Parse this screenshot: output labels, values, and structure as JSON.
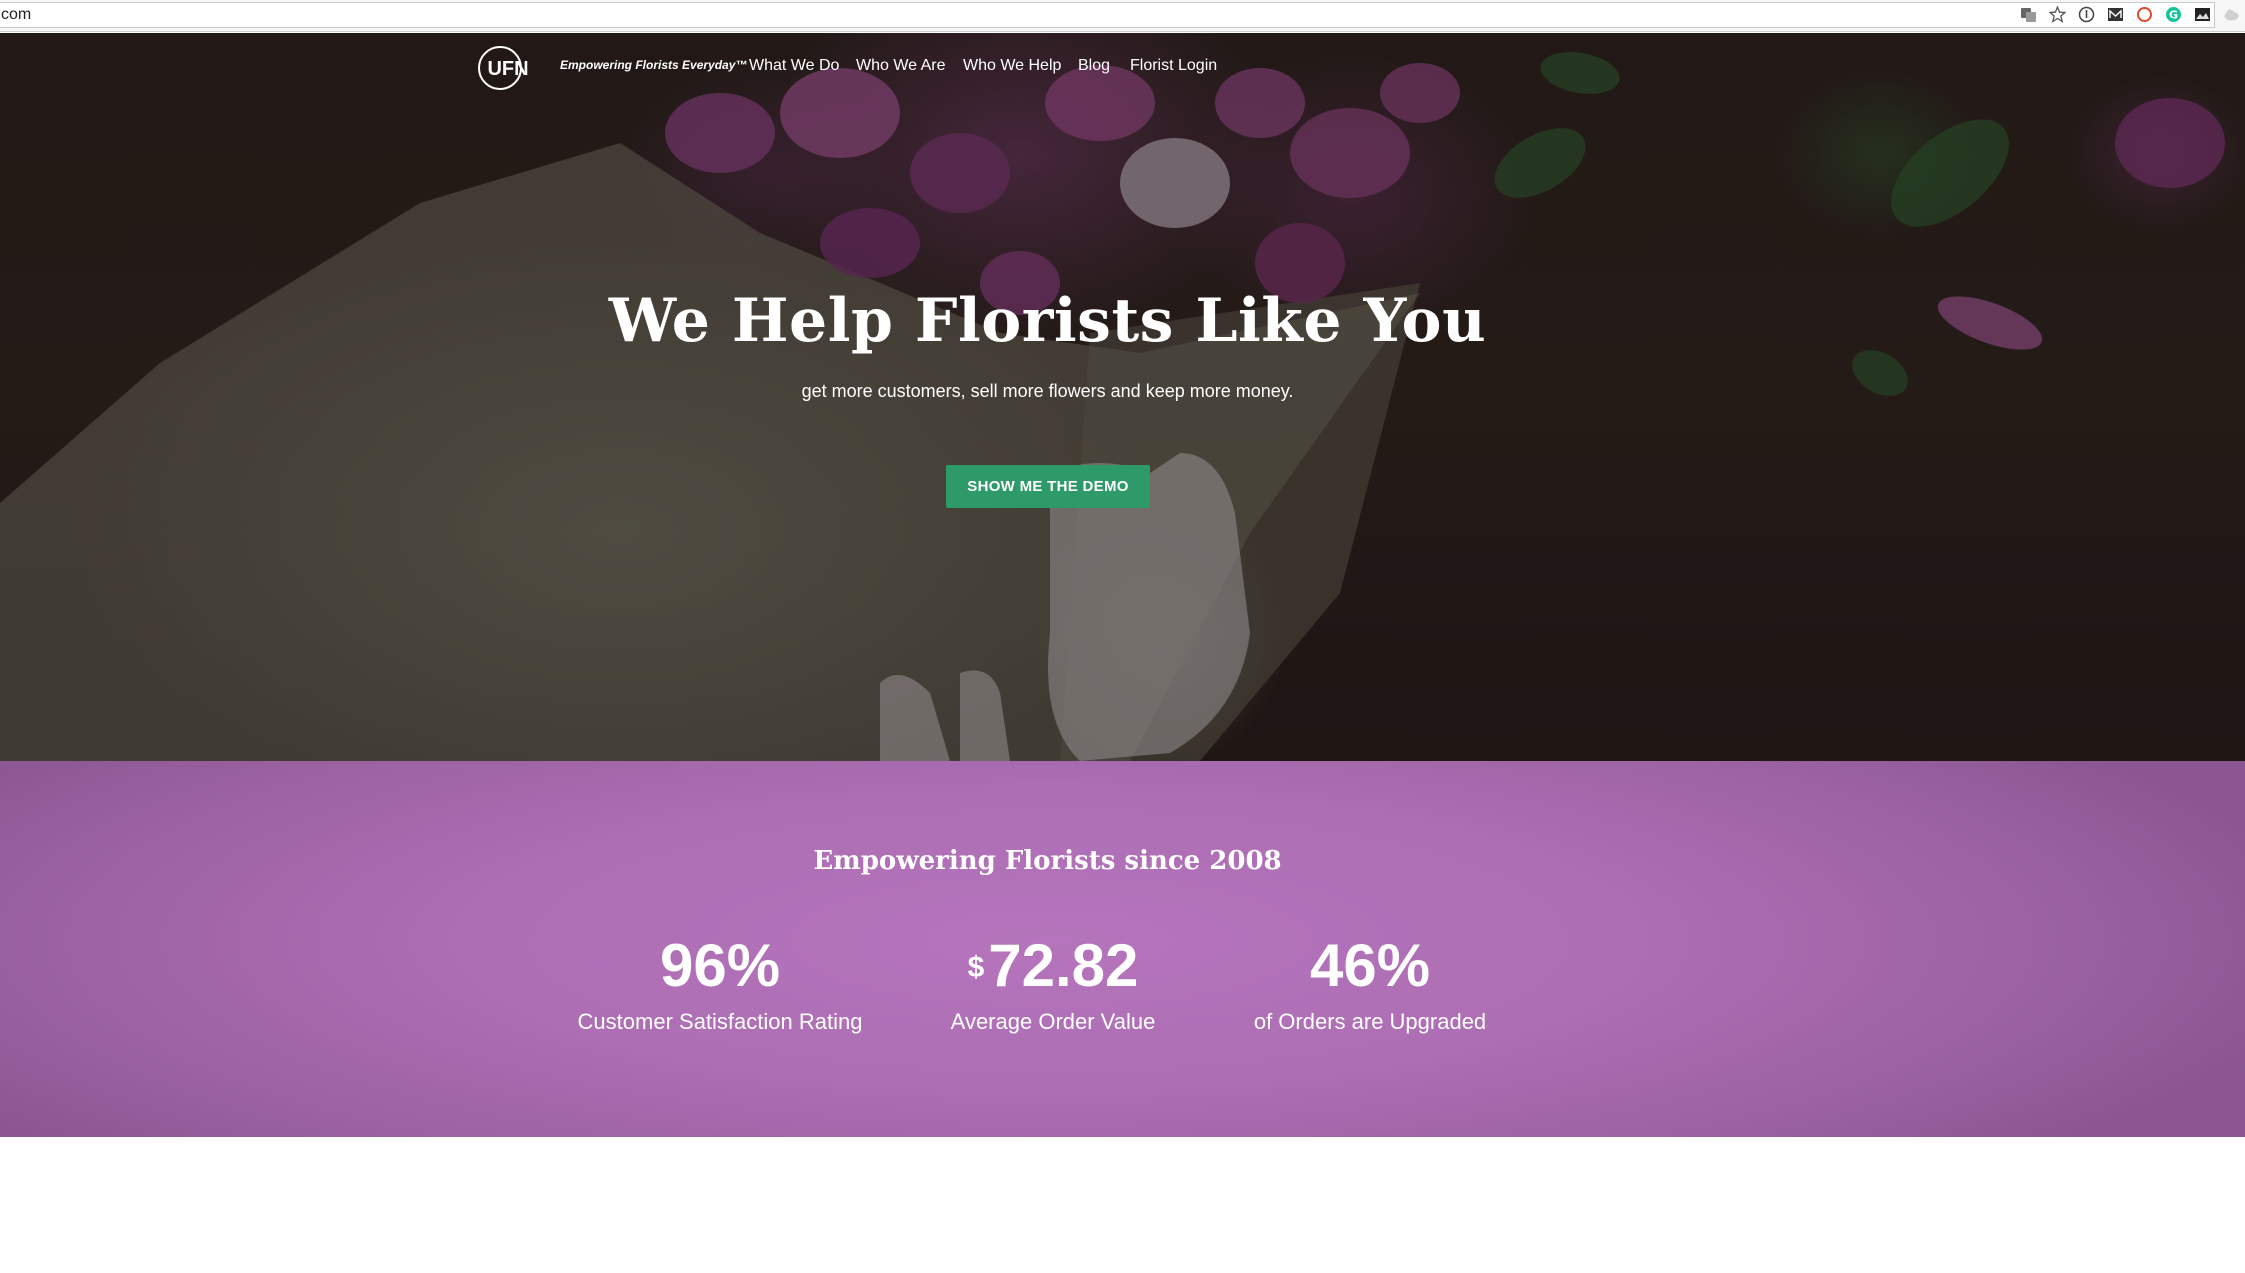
{
  "browser": {
    "url": "com"
  },
  "nav": {
    "logo_text": "UFN",
    "tagline": "Empowering Florists Everyday™",
    "links": [
      {
        "label": "What We Do"
      },
      {
        "label": "Who We Are"
      },
      {
        "label": "Who We Help"
      },
      {
        "label": "Blog"
      },
      {
        "label": "Florist Login"
      }
    ]
  },
  "hero": {
    "title": "We Help Florists Like You",
    "subtitle": "get more customers, sell more flowers and keep more money.",
    "cta_label": "SHOW ME THE DEMO",
    "cta_color": "#2e9a6a"
  },
  "stats": {
    "heading": "Empowering Florists since 2008",
    "background_color": "#ad6eb4",
    "items": [
      {
        "prefix": "",
        "value": "96%",
        "label": "Customer Satisfaction Rating"
      },
      {
        "prefix": "$",
        "value": "72.82",
        "label": "Average Order Value"
      },
      {
        "prefix": "",
        "value": "46%",
        "label": "of Orders are Upgraded"
      }
    ]
  }
}
